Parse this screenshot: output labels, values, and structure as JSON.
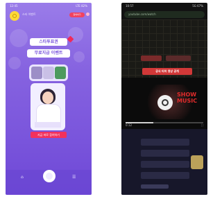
{
  "left_phone": {
    "status": {
      "time": "12:45",
      "icons": "LTE 82%"
    },
    "header_text": "스타 이벤트",
    "header_pill": "참여하기",
    "banner": {
      "line1": "스타투표권",
      "line2": "무료지급 이벤트"
    },
    "cta": "지금 바로 참여하기",
    "nav": {
      "left": "⌂",
      "right": "☰"
    }
  },
  "right_phone": {
    "status": {
      "time": "10:57",
      "icons": "5G 67%"
    },
    "url": "youtube.com/watch",
    "headline": "공식 티저 영상 공개",
    "logo_text": "SHOW MUSIC",
    "progress": 0.36,
    "controls": {
      "left": "0:12",
      "right": "⛶"
    }
  }
}
